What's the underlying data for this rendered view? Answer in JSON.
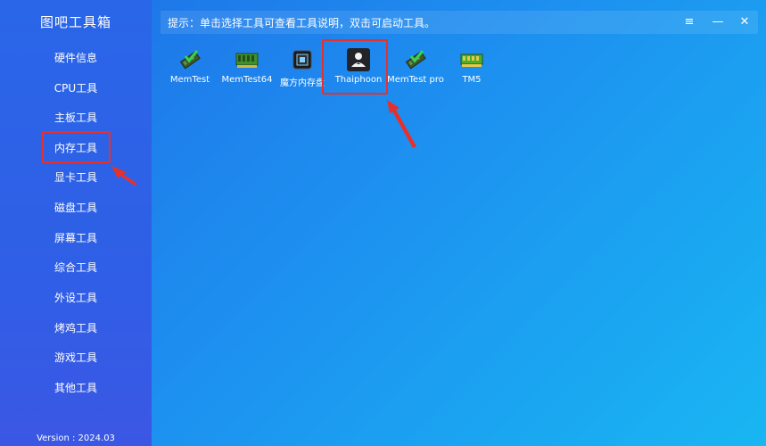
{
  "app": {
    "title": "图吧工具箱",
    "version": "Version : 2024.03"
  },
  "header": {
    "hint": "提示：单击选择工具可查看工具说明，双击可启动工具。",
    "menu_glyph": "≡",
    "minimize_glyph": "—",
    "close_glyph": "✕"
  },
  "sidebar": {
    "items": [
      {
        "label": "硬件信息"
      },
      {
        "label": "CPU工具"
      },
      {
        "label": "主板工具"
      },
      {
        "label": "内存工具"
      },
      {
        "label": "显卡工具"
      },
      {
        "label": "磁盘工具"
      },
      {
        "label": "屏幕工具"
      },
      {
        "label": "综合工具"
      },
      {
        "label": "外设工具"
      },
      {
        "label": "烤鸡工具"
      },
      {
        "label": "游戏工具"
      },
      {
        "label": "其他工具"
      }
    ],
    "active_index": 3
  },
  "tools": [
    {
      "label": "MemTest",
      "icon": "ram-check-icon"
    },
    {
      "label": "MemTest64",
      "icon": "ram-module-icon"
    },
    {
      "label": "魔方内存盘",
      "icon": "chip-icon"
    },
    {
      "label": "Thaiphoon",
      "icon": "thaiphoon-logo-icon"
    },
    {
      "label": "MemTest pro",
      "icon": "ram-check-icon"
    },
    {
      "label": "TM5",
      "icon": "ram-module-icon"
    }
  ],
  "colors": {
    "highlight": "#e8302a",
    "sidebar": "#2f5fe6",
    "accent": "#19b6f2"
  }
}
